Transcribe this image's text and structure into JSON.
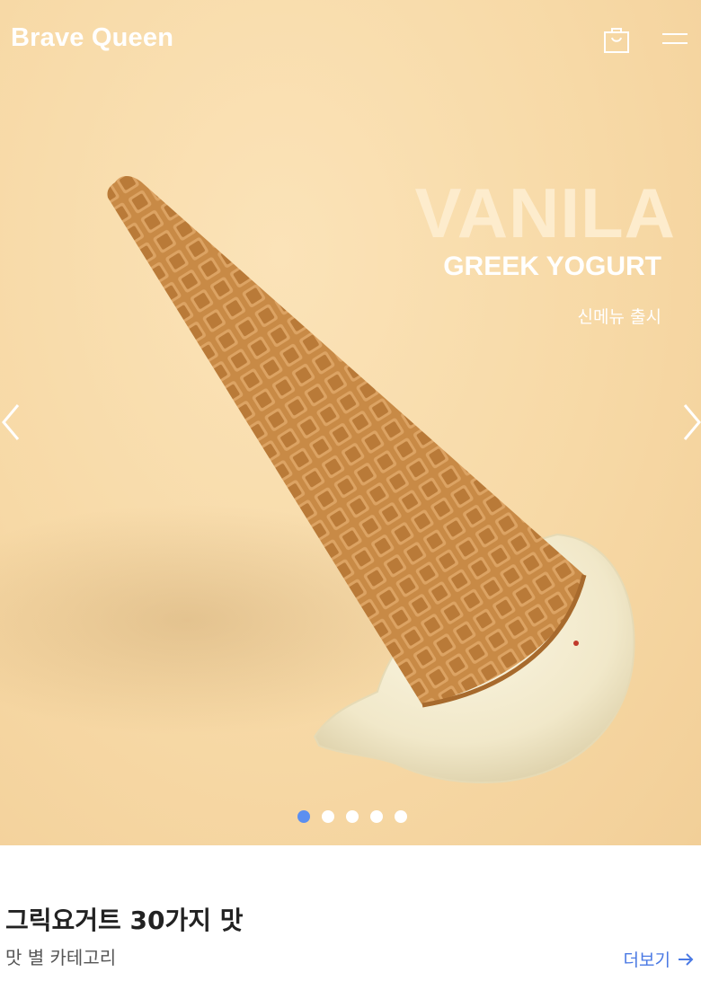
{
  "header": {
    "brand": "Brave Queen",
    "cart_icon": "shopping-bag-icon",
    "menu_icon": "hamburger-menu-icon"
  },
  "hero": {
    "title": "VANILA",
    "subtitle": "GREEK YOGURT",
    "tag": "신메뉴 출시",
    "prev_icon": "chevron-left-icon",
    "next_icon": "chevron-right-icon",
    "slides_total": 5,
    "active_slide": 1,
    "colors": {
      "background": "#f7d9a6",
      "title": "#fdeccd",
      "active_dot": "#5b8ff0"
    }
  },
  "section": {
    "title": "그릭요거트 30가지 맛",
    "subtitle": "맛 별 카테고리",
    "more_label": "더보기",
    "more_icon": "arrow-right-icon",
    "accent": "#4a79e4"
  }
}
